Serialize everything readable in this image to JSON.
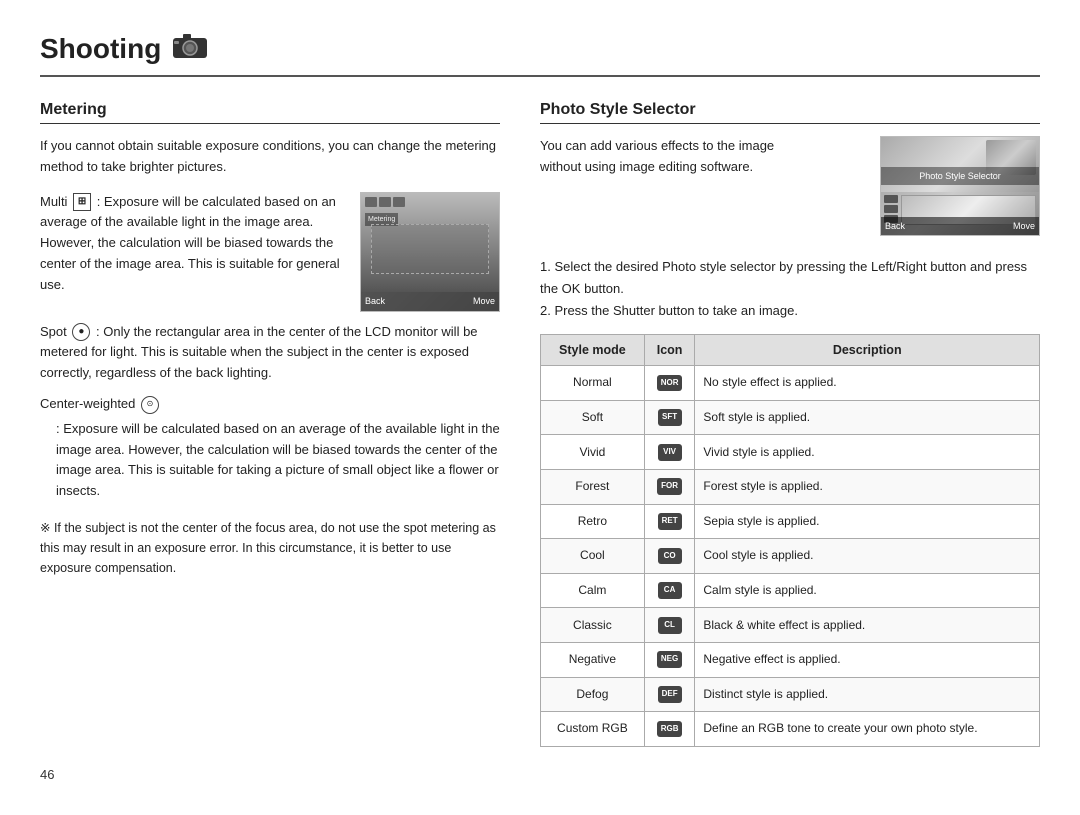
{
  "page": {
    "title": "Shooting",
    "camera_icon": "📷",
    "page_number": "46"
  },
  "metering": {
    "section_title": "Metering",
    "intro": "If you cannot obtain suitable exposure conditions, you can change the metering method to take brighter pictures.",
    "multi_label": "Multi",
    "multi_desc1": ": Exposure will be calculated based on an average of the available light in the image area. However, the calculation will be biased towards the center of the image area. This is suitable for general use.",
    "spot_label": "Spot",
    "spot_desc": ": Only the rectangular area in the center of the LCD monitor will be metered for light. This is suitable when the subject in the center is exposed correctly, regardless of the back lighting.",
    "cw_label": "Center-weighted",
    "cw_desc": ": Exposure will be calculated based on an average of the available light in the image area. However, the calculation will be biased towards the center of the image area. This is suitable for taking a picture of small object like a flower or insects.",
    "note": "※ If the subject is not the center of the focus area, do not use the spot metering as this may result in an exposure error. In this circumstance, it is better to use exposure compensation.",
    "img_back": "Back",
    "img_move": "Move"
  },
  "photo_style": {
    "section_title": "Photo Style Selector",
    "intro1": "You can add various effects to the image",
    "intro2": "without using image editing software.",
    "step1": "1. Select the desired Photo style selector by pressing the Left/Right button and press the OK button.",
    "step2": "2. Press the Shutter button to take an image.",
    "img_title": "Photo Style Selector",
    "img_back": "Back",
    "img_move": "Move",
    "table": {
      "headers": [
        "Style mode",
        "Icon",
        "Description"
      ],
      "rows": [
        {
          "mode": "Normal",
          "icon": "NOR",
          "desc": "No style effect is applied."
        },
        {
          "mode": "Soft",
          "icon": "SFT",
          "desc": "Soft style is applied."
        },
        {
          "mode": "Vivid",
          "icon": "VIV",
          "desc": "Vivid style is applied."
        },
        {
          "mode": "Forest",
          "icon": "FOR",
          "desc": "Forest style is applied."
        },
        {
          "mode": "Retro",
          "icon": "RET",
          "desc": "Sepia style is applied."
        },
        {
          "mode": "Cool",
          "icon": "CO",
          "desc": "Cool style is applied."
        },
        {
          "mode": "Calm",
          "icon": "CA",
          "desc": "Calm style is applied."
        },
        {
          "mode": "Classic",
          "icon": "CL",
          "desc": "Black & white effect is applied."
        },
        {
          "mode": "Negative",
          "icon": "NEG",
          "desc": "Negative effect is applied."
        },
        {
          "mode": "Defog",
          "icon": "DEF",
          "desc": "Distinct style is applied."
        },
        {
          "mode": "Custom RGB",
          "icon": "RGB",
          "desc": "Define an RGB tone to create your own photo style."
        }
      ]
    }
  }
}
